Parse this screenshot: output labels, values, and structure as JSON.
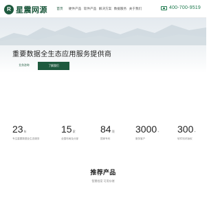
{
  "header": {
    "logo_mark": "R",
    "logo_text": "星震网源",
    "nav": [
      "首页",
      "硬件产品",
      "软件产品",
      "解决方案",
      "数据服务",
      "关于我们"
    ],
    "phone": "400-700-9519"
  },
  "hero": {
    "title": "重要数据全生态应用服务提供商",
    "btn_outline": "业务咨询",
    "btn_primary": "了解我们"
  },
  "stats": [
    {
      "num": "23",
      "unit": "年",
      "label": "专注重要数据全生态服务"
    },
    {
      "num": "15",
      "unit": "家",
      "label": "全国布局及分部"
    },
    {
      "num": "84",
      "unit": "项",
      "label": "国家专利"
    },
    {
      "num": "3000",
      "unit": "+",
      "label": "服务客户"
    },
    {
      "num": "300",
      "unit": "+",
      "label": "软件知识版权"
    }
  ],
  "products": {
    "title": "推荐产品",
    "subtitle": "智慧档案  可用存储"
  },
  "colors": {
    "brand": "#1e5a3e",
    "phone": "#1e7a4e"
  }
}
